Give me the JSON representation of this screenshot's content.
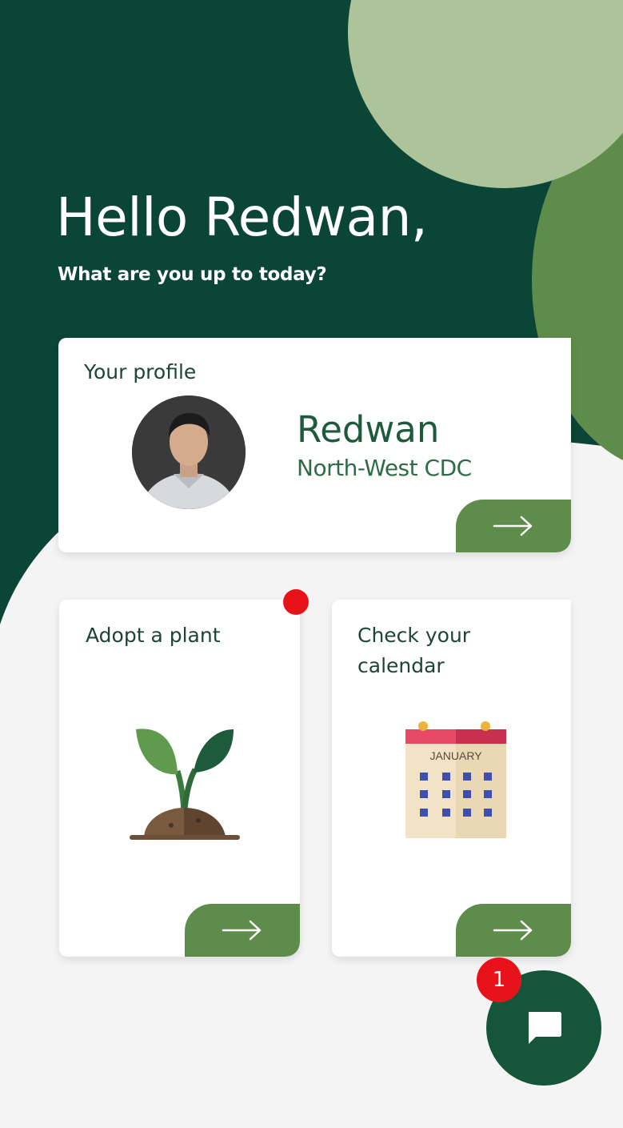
{
  "header": {
    "greeting": "Hello Redwan,",
    "subtitle": "What are you up to today?"
  },
  "profile_card": {
    "title": "Your profile",
    "name": "Redwan",
    "organization": "North-West CDC",
    "avatar": "user-photo"
  },
  "adopt_card": {
    "title": "Adopt a plant",
    "icon": "sprout-icon",
    "has_notification": true
  },
  "calendar_card": {
    "title_line1": "Check your",
    "title_line2": "calendar",
    "icon": "calendar-icon",
    "month": "JANUARY"
  },
  "chat": {
    "icon": "chat-bubble-icon",
    "badge_count": "1"
  },
  "colors": {
    "dark_green": "#0b4536",
    "medium_green": "#5e8c4b",
    "light_green": "#adc39a",
    "name_green": "#1e5a3c",
    "notification_red": "#e8131a",
    "background": "#f4f4f4"
  }
}
